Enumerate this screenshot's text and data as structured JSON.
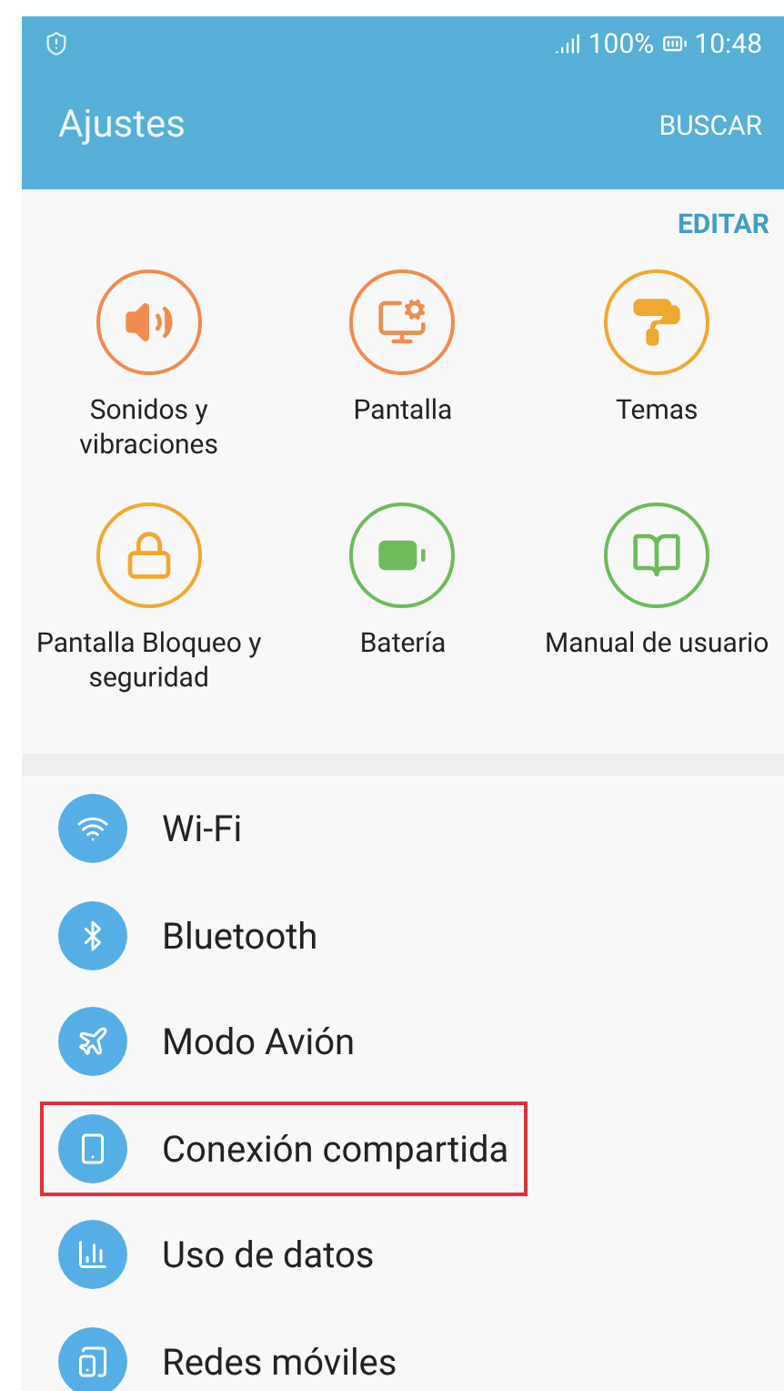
{
  "status_bar": {
    "battery": "100%",
    "time": "10:48"
  },
  "app_bar": {
    "title": "Ajustes",
    "action": "BUSCAR"
  },
  "quick_settings": {
    "edit": "EDITAR",
    "tiles": [
      {
        "label": "Sonidos y vibraciones",
        "color": "#f08c50"
      },
      {
        "label": "Pantalla",
        "color": "#f08c50"
      },
      {
        "label": "Temas",
        "color": "#f0a830"
      },
      {
        "label": "Pantalla Bloqueo y seguridad",
        "color": "#f0a830"
      },
      {
        "label": "Batería",
        "color": "#6dbb5a"
      },
      {
        "label": "Manual de usuario",
        "color": "#6dbb5a"
      }
    ]
  },
  "settings_list": [
    {
      "label": "Wi-Fi",
      "highlighted": false
    },
    {
      "label": "Bluetooth",
      "highlighted": false
    },
    {
      "label": "Modo Avión",
      "highlighted": false
    },
    {
      "label": "Conexión compartida",
      "highlighted": true
    },
    {
      "label": "Uso de datos",
      "highlighted": false
    },
    {
      "label": "Redes móviles",
      "highlighted": false
    }
  ]
}
